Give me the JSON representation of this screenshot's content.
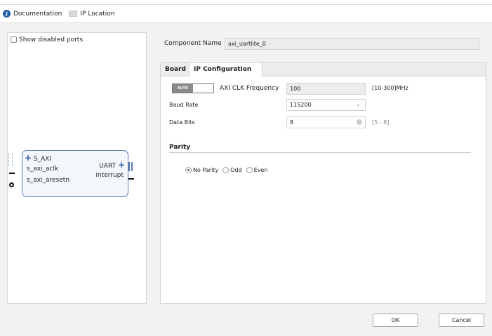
{
  "toolbar": {
    "documentation": "Documentation",
    "ip_location": "IP Location"
  },
  "left_panel": {
    "show_disabled_ports": "Show disabled ports",
    "block": {
      "ports_left": [
        "S_AXI",
        "s_axi_aclk",
        "s_axi_aresetn"
      ],
      "ports_right": [
        "UART",
        "interrupt"
      ]
    }
  },
  "component_name": {
    "label": "Component Name",
    "value": "axi_uartlite_0"
  },
  "tabs": [
    {
      "label": "Board",
      "active": false
    },
    {
      "label": "IP Configuration",
      "active": true
    }
  ],
  "config": {
    "auto_toggle": "AUTO",
    "axi_clk": {
      "label": "AXI CLK Frequency",
      "value": "100",
      "range": "[10-300]MHz"
    },
    "baud_rate": {
      "label": "Baud Rate",
      "value": "115200"
    },
    "data_bits": {
      "label": "Data Bits",
      "value": "8",
      "range": "[5 - 8]"
    },
    "parity": {
      "title": "Parity",
      "options": [
        "No Parity",
        "Odd",
        "Even"
      ],
      "selected": "No Parity"
    }
  },
  "buttons": {
    "ok": "OK",
    "cancel": "Cancel"
  }
}
